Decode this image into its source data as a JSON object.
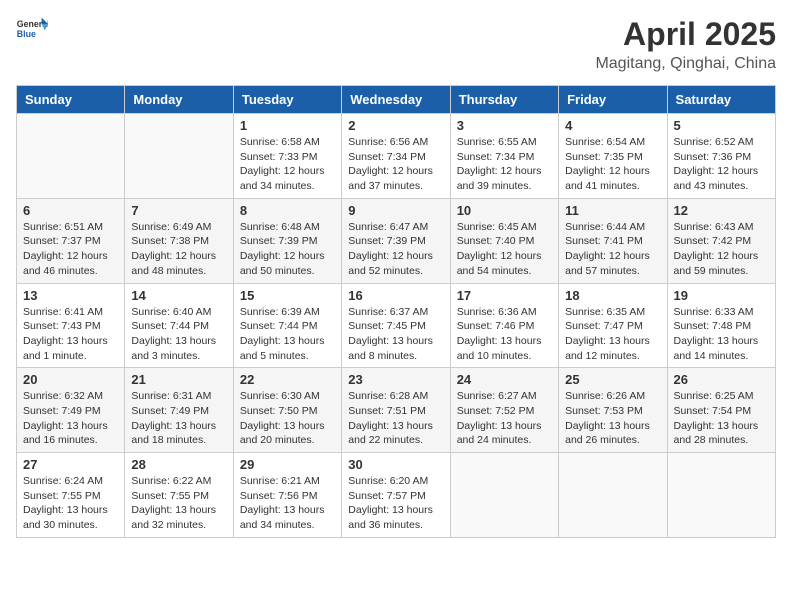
{
  "header": {
    "logo_general": "General",
    "logo_blue": "Blue",
    "title": "April 2025",
    "subtitle": "Magitang, Qinghai, China"
  },
  "weekdays": [
    "Sunday",
    "Monday",
    "Tuesday",
    "Wednesday",
    "Thursday",
    "Friday",
    "Saturday"
  ],
  "weeks": [
    [
      {
        "day": "",
        "detail": ""
      },
      {
        "day": "",
        "detail": ""
      },
      {
        "day": "1",
        "detail": "Sunrise: 6:58 AM\nSunset: 7:33 PM\nDaylight: 12 hours and 34 minutes."
      },
      {
        "day": "2",
        "detail": "Sunrise: 6:56 AM\nSunset: 7:34 PM\nDaylight: 12 hours and 37 minutes."
      },
      {
        "day": "3",
        "detail": "Sunrise: 6:55 AM\nSunset: 7:34 PM\nDaylight: 12 hours and 39 minutes."
      },
      {
        "day": "4",
        "detail": "Sunrise: 6:54 AM\nSunset: 7:35 PM\nDaylight: 12 hours and 41 minutes."
      },
      {
        "day": "5",
        "detail": "Sunrise: 6:52 AM\nSunset: 7:36 PM\nDaylight: 12 hours and 43 minutes."
      }
    ],
    [
      {
        "day": "6",
        "detail": "Sunrise: 6:51 AM\nSunset: 7:37 PM\nDaylight: 12 hours and 46 minutes."
      },
      {
        "day": "7",
        "detail": "Sunrise: 6:49 AM\nSunset: 7:38 PM\nDaylight: 12 hours and 48 minutes."
      },
      {
        "day": "8",
        "detail": "Sunrise: 6:48 AM\nSunset: 7:39 PM\nDaylight: 12 hours and 50 minutes."
      },
      {
        "day": "9",
        "detail": "Sunrise: 6:47 AM\nSunset: 7:39 PM\nDaylight: 12 hours and 52 minutes."
      },
      {
        "day": "10",
        "detail": "Sunrise: 6:45 AM\nSunset: 7:40 PM\nDaylight: 12 hours and 54 minutes."
      },
      {
        "day": "11",
        "detail": "Sunrise: 6:44 AM\nSunset: 7:41 PM\nDaylight: 12 hours and 57 minutes."
      },
      {
        "day": "12",
        "detail": "Sunrise: 6:43 AM\nSunset: 7:42 PM\nDaylight: 12 hours and 59 minutes."
      }
    ],
    [
      {
        "day": "13",
        "detail": "Sunrise: 6:41 AM\nSunset: 7:43 PM\nDaylight: 13 hours and 1 minute."
      },
      {
        "day": "14",
        "detail": "Sunrise: 6:40 AM\nSunset: 7:44 PM\nDaylight: 13 hours and 3 minutes."
      },
      {
        "day": "15",
        "detail": "Sunrise: 6:39 AM\nSunset: 7:44 PM\nDaylight: 13 hours and 5 minutes."
      },
      {
        "day": "16",
        "detail": "Sunrise: 6:37 AM\nSunset: 7:45 PM\nDaylight: 13 hours and 8 minutes."
      },
      {
        "day": "17",
        "detail": "Sunrise: 6:36 AM\nSunset: 7:46 PM\nDaylight: 13 hours and 10 minutes."
      },
      {
        "day": "18",
        "detail": "Sunrise: 6:35 AM\nSunset: 7:47 PM\nDaylight: 13 hours and 12 minutes."
      },
      {
        "day": "19",
        "detail": "Sunrise: 6:33 AM\nSunset: 7:48 PM\nDaylight: 13 hours and 14 minutes."
      }
    ],
    [
      {
        "day": "20",
        "detail": "Sunrise: 6:32 AM\nSunset: 7:49 PM\nDaylight: 13 hours and 16 minutes."
      },
      {
        "day": "21",
        "detail": "Sunrise: 6:31 AM\nSunset: 7:49 PM\nDaylight: 13 hours and 18 minutes."
      },
      {
        "day": "22",
        "detail": "Sunrise: 6:30 AM\nSunset: 7:50 PM\nDaylight: 13 hours and 20 minutes."
      },
      {
        "day": "23",
        "detail": "Sunrise: 6:28 AM\nSunset: 7:51 PM\nDaylight: 13 hours and 22 minutes."
      },
      {
        "day": "24",
        "detail": "Sunrise: 6:27 AM\nSunset: 7:52 PM\nDaylight: 13 hours and 24 minutes."
      },
      {
        "day": "25",
        "detail": "Sunrise: 6:26 AM\nSunset: 7:53 PM\nDaylight: 13 hours and 26 minutes."
      },
      {
        "day": "26",
        "detail": "Sunrise: 6:25 AM\nSunset: 7:54 PM\nDaylight: 13 hours and 28 minutes."
      }
    ],
    [
      {
        "day": "27",
        "detail": "Sunrise: 6:24 AM\nSunset: 7:55 PM\nDaylight: 13 hours and 30 minutes."
      },
      {
        "day": "28",
        "detail": "Sunrise: 6:22 AM\nSunset: 7:55 PM\nDaylight: 13 hours and 32 minutes."
      },
      {
        "day": "29",
        "detail": "Sunrise: 6:21 AM\nSunset: 7:56 PM\nDaylight: 13 hours and 34 minutes."
      },
      {
        "day": "30",
        "detail": "Sunrise: 6:20 AM\nSunset: 7:57 PM\nDaylight: 13 hours and 36 minutes."
      },
      {
        "day": "",
        "detail": ""
      },
      {
        "day": "",
        "detail": ""
      },
      {
        "day": "",
        "detail": ""
      }
    ]
  ]
}
